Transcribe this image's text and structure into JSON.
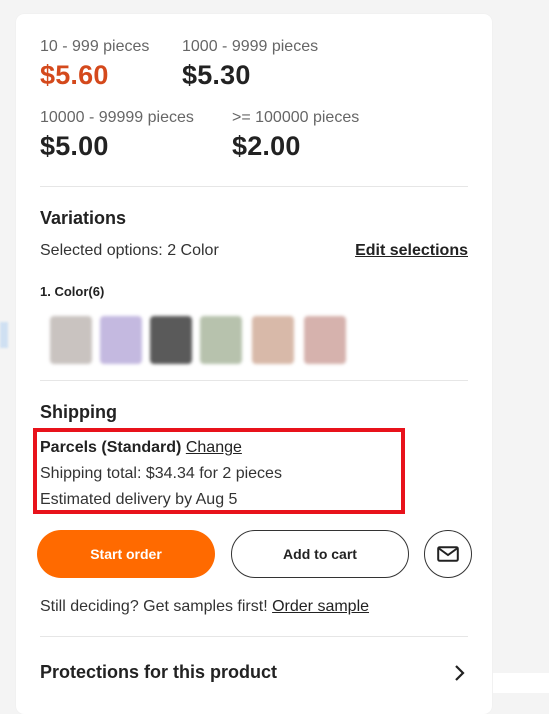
{
  "pricing": {
    "tiers": [
      {
        "range": "10 - 999 pieces",
        "price": "$5.60"
      },
      {
        "range": "1000 - 9999 pieces",
        "price": "$5.30"
      },
      {
        "range": "10000 - 99999 pieces",
        "price": "$5.00"
      },
      {
        "range": ">= 100000 pieces",
        "price": "$2.00"
      }
    ],
    "highlight_color": "#d4491c"
  },
  "variations": {
    "title": "Variations",
    "selected_prefix": "Selected options: ",
    "selected_value": "2 Color",
    "edit_label": "Edit selections",
    "color_group_label": "1. Color(6)",
    "swatch_colors": [
      "#c9c3c0",
      "#c4b9e0",
      "#5a5a5a",
      "#b7c2ad",
      "#d8b9a9",
      "#d6b2ad"
    ]
  },
  "shipping": {
    "title": "Shipping",
    "method": "Parcels (Standard)",
    "change_label": "Change",
    "total": "Shipping total: $34.34 for 2 pieces",
    "delivery": "Estimated delivery by Aug 5"
  },
  "actions": {
    "start_order": "Start order",
    "add_to_cart": "Add to cart",
    "message_icon": "envelope-icon",
    "primary_color": "#ff6a00"
  },
  "samples": {
    "prefix": "Still deciding? Get samples first! ",
    "link": "Order sample"
  },
  "protections": {
    "title": "Protections for this product",
    "icon": "chevron-right-icon"
  }
}
